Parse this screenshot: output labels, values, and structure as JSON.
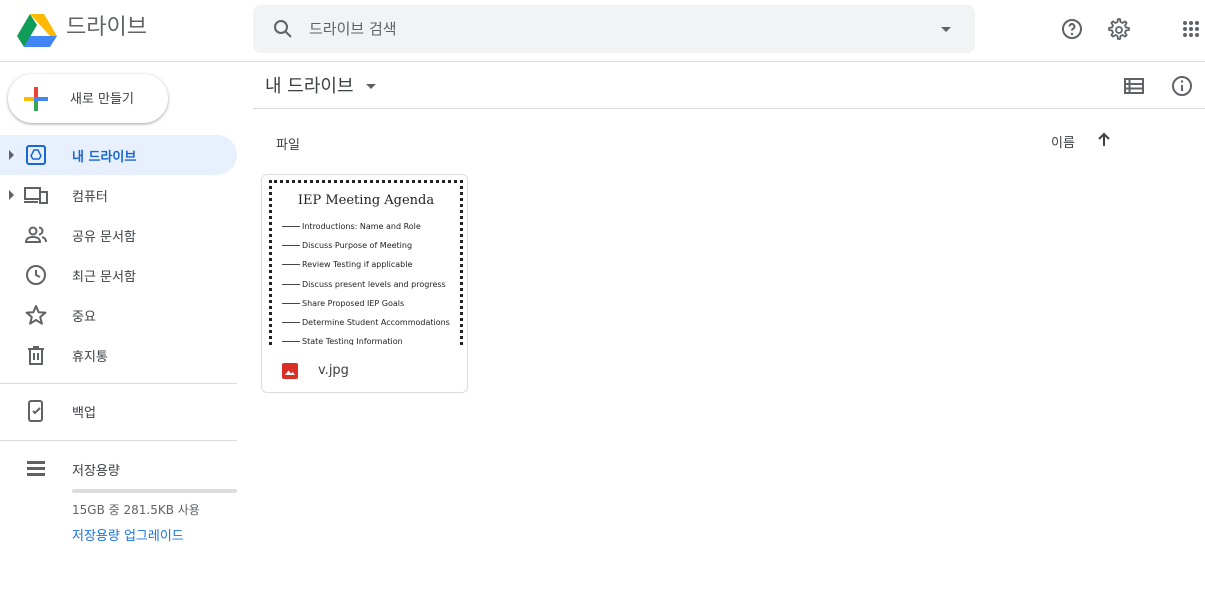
{
  "header": {
    "app_title": "드라이브",
    "search_placeholder": "드라이브 검색"
  },
  "sidebar": {
    "new_button": "새로 만들기",
    "items": [
      {
        "label": "내 드라이브",
        "icon": "my-drive-icon",
        "active": true
      },
      {
        "label": "컴퓨터",
        "icon": "computers-icon"
      },
      {
        "label": "공유 문서함",
        "icon": "shared-people-icon"
      },
      {
        "label": "최근 문서함",
        "icon": "clock-icon"
      },
      {
        "label": "중요",
        "icon": "star-icon"
      },
      {
        "label": "휴지통",
        "icon": "trash-icon"
      },
      {
        "label": "백업",
        "icon": "backup-icon"
      },
      {
        "label": "저장용량",
        "icon": "storage-icon"
      }
    ],
    "storage_usage": "15GB 중 281.5KB 사용",
    "storage_upgrade": "저장용량 업그레이드"
  },
  "main": {
    "title": "내 드라이브",
    "section_label": "파일",
    "sort_label": "이름",
    "file": {
      "name": "v.jpg",
      "thumbnail": {
        "title": "IEP Meeting Agenda",
        "lines": [
          "Introductions: Name and Role",
          "Discuss Purpose of Meeting",
          "Review Testing if applicable",
          "Discuss present levels and progress",
          "Share Proposed IEP Goals",
          "Determine Student Accommodations",
          "State Testing Information"
        ]
      }
    }
  },
  "colors": {
    "accent_blue": "#1a73e8",
    "active_bg": "#e8f0fe",
    "image_file_red": "#d93025"
  }
}
